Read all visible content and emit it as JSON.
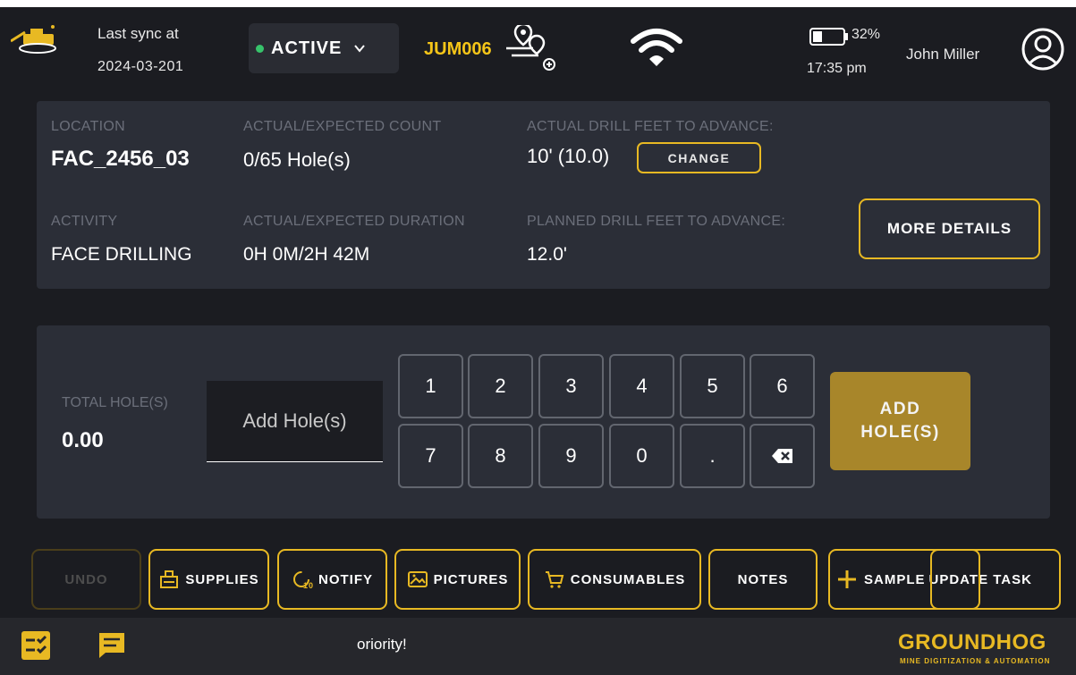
{
  "header": {
    "sync_label": "Last sync at",
    "sync_date": "2024-03-201",
    "status": "ACTIVE",
    "machine_id": "JUM006",
    "battery_pct": "32%",
    "time": "17:35 pm",
    "user_name": "John Miller"
  },
  "info": {
    "location_label": "LOCATION",
    "location_value": "FAC_2456_03",
    "count_label": "ACTUAL/EXPECTED COUNT",
    "count_value": "0/65 Hole(s)",
    "actual_drill_label": "ACTUAL DRILL FEET TO ADVANCE:",
    "actual_drill_value": "10' (10.0)",
    "change_label": "CHANGE",
    "activity_label": "ACTIVITY",
    "activity_value": "FACE DRILLING",
    "duration_label": "ACTUAL/EXPECTED DURATION",
    "duration_value": "0H 0M/2H 42M",
    "planned_drill_label": "PLANNED DRILL FEET TO ADVANCE:",
    "planned_drill_value": "12.0'",
    "more_details_label": "MORE DETAILS"
  },
  "keypad": {
    "total_label": "TOTAL HOLE(S)",
    "total_value": "0.00",
    "input_placeholder": "Add Hole(s)",
    "keys": [
      "1",
      "2",
      "3",
      "4",
      "5",
      "6",
      "7",
      "8",
      "9",
      "0",
      "."
    ],
    "add_label_line1": "ADD",
    "add_label_line2": "HOLE(S)"
  },
  "actions": {
    "undo": "UNDO",
    "supplies": "SUPPLIES",
    "notify": "NOTIFY",
    "pictures": "PICTURES",
    "consumables": "CONSUMABLES",
    "notes": "NOTES",
    "sample": "SAMPLE",
    "update_task": "UPDATE TASK"
  },
  "footer": {
    "ticker": "oriority!",
    "brand": "GROUNDHOG",
    "tagline": "MINE DIGITIZATION & AUTOMATION"
  },
  "colors": {
    "accent": "#e8b923",
    "active": "#37c36b",
    "add_button": "#a8862a"
  }
}
